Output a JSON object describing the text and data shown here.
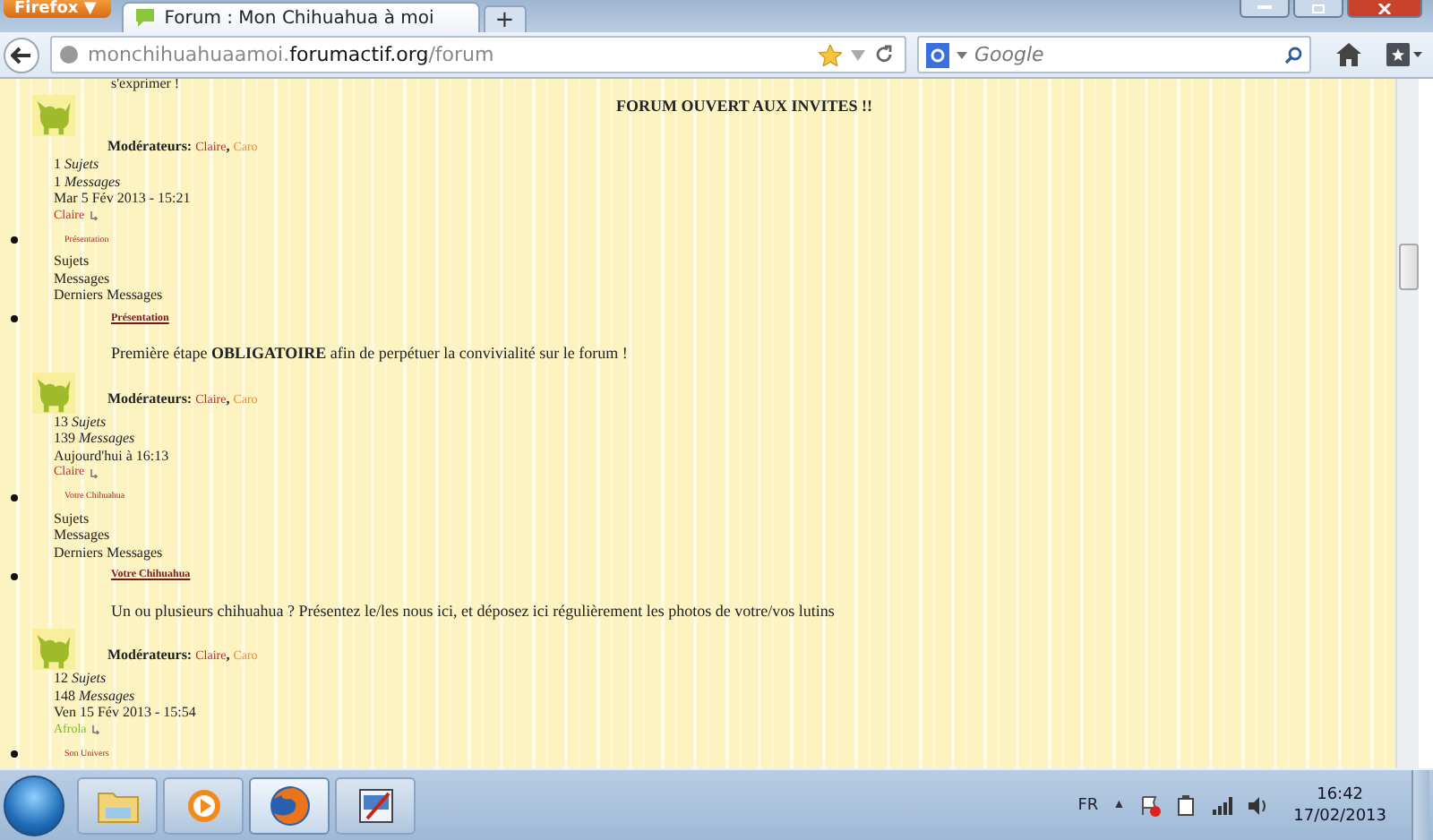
{
  "browser": {
    "menu_button": "Firefox",
    "menu_arrow": "▼",
    "tab": {
      "title": "Forum : Mon Chihuahua à moi",
      "selected": true
    },
    "new_tab": "+",
    "url_parts": [
      {
        "text": "monchihuahuaamoi.",
        "strong": false
      },
      {
        "text": "forumactif.org",
        "strong": true
      },
      {
        "text": "/forum",
        "strong": false
      }
    ],
    "search": {
      "placeholder": "Google"
    }
  },
  "page": {
    "intro_text": "s'exprimer !",
    "blocks": [
      {
        "kind": "forum",
        "description": "FORUM OUVERT AUX INVITES !!",
        "banner": true,
        "moderators_label": "Modérateurs:",
        "moderator_separator": ",",
        "moderators": [
          {
            "name": "Claire",
            "color": "#d0203c"
          },
          {
            "name": "Caro",
            "color": "#f0883a"
          }
        ],
        "topics": "1",
        "topics_label": "Sujets",
        "posts": "1",
        "posts_label": "Messages",
        "last_date": "Mar 5 Fév 2013 - 15:21",
        "last_author": {
          "name": "Claire",
          "color": "#d0203c"
        }
      },
      {
        "kind": "header",
        "title": "Présentation",
        "labels": [
          "Sujets",
          "Messages",
          "Derniers Messages"
        ]
      },
      {
        "kind": "forum",
        "title": "Présentation",
        "description": "Première étape **OBLIGATOIRE** afin de perpétuer la convivialité sur le forum !",
        "banner": false,
        "moderators_label": "Modérateurs:",
        "moderator_separator": ",",
        "moderators": [
          {
            "name": "Claire",
            "color": "#d0203c"
          },
          {
            "name": "Caro",
            "color": "#f0883a"
          }
        ],
        "topics": "13",
        "topics_label": "Sujets",
        "posts": "139",
        "posts_label": "Messages",
        "last_date": "Aujourd'hui à 16:13",
        "last_author": {
          "name": "Claire",
          "color": "#d0203c"
        }
      },
      {
        "kind": "header",
        "title": "Votre Chihuahua",
        "labels": [
          "Sujets",
          "Messages",
          "Derniers Messages"
        ]
      },
      {
        "kind": "forum",
        "title": "Votre Chihuahua",
        "description": "Un ou plusieurs chihuahua ? Présentez le/les nous ici, et déposez ici régulièrement les photos de votre/vos lutins",
        "banner": false,
        "moderators_label": "Modérateurs:",
        "moderator_separator": ",",
        "moderators": [
          {
            "name": "Claire",
            "color": "#d0203c"
          },
          {
            "name": "Caro",
            "color": "#f0883a"
          }
        ],
        "topics": "12",
        "topics_label": "Sujets",
        "posts": "148",
        "posts_label": "Messages",
        "last_date": "Ven 15 Fév 2013 - 15:54",
        "last_author": {
          "name": "Afrola",
          "color": "#7cb82f"
        }
      },
      {
        "kind": "header",
        "title": "Son Univers"
      }
    ]
  },
  "taskbar": {
    "apps": [
      {
        "kind": "folder",
        "selected": false
      },
      {
        "kind": "media",
        "selected": false
      },
      {
        "kind": "browser",
        "selected": true
      },
      {
        "kind": "paint",
        "selected": false
      }
    ],
    "language": "FR",
    "tray_toggle": "▲",
    "time": "16:42",
    "date": "17/02/2013"
  }
}
